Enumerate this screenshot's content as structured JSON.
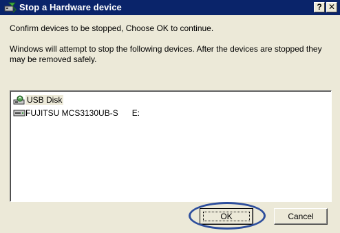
{
  "window": {
    "title": "Stop a Hardware device",
    "help_label": "?",
    "close_label": "✕"
  },
  "messages": {
    "confirm": "Confirm devices to be stopped, Choose OK to continue.",
    "info": "Windows will attempt to stop the following devices. After the devices are stopped they may be removed safely."
  },
  "devices": [
    {
      "label": "USB Disk",
      "icon": "usb-disk-icon"
    },
    {
      "label": "FUJITSU MCS3130UB-S",
      "drive": "E:",
      "icon": "drive-icon"
    }
  ],
  "buttons": {
    "ok": "OK",
    "cancel": "Cancel"
  },
  "colors": {
    "titlebar": "#0A246A",
    "dialog_bg": "#ECE9D8",
    "highlight_ring": "#2D4E9C"
  }
}
